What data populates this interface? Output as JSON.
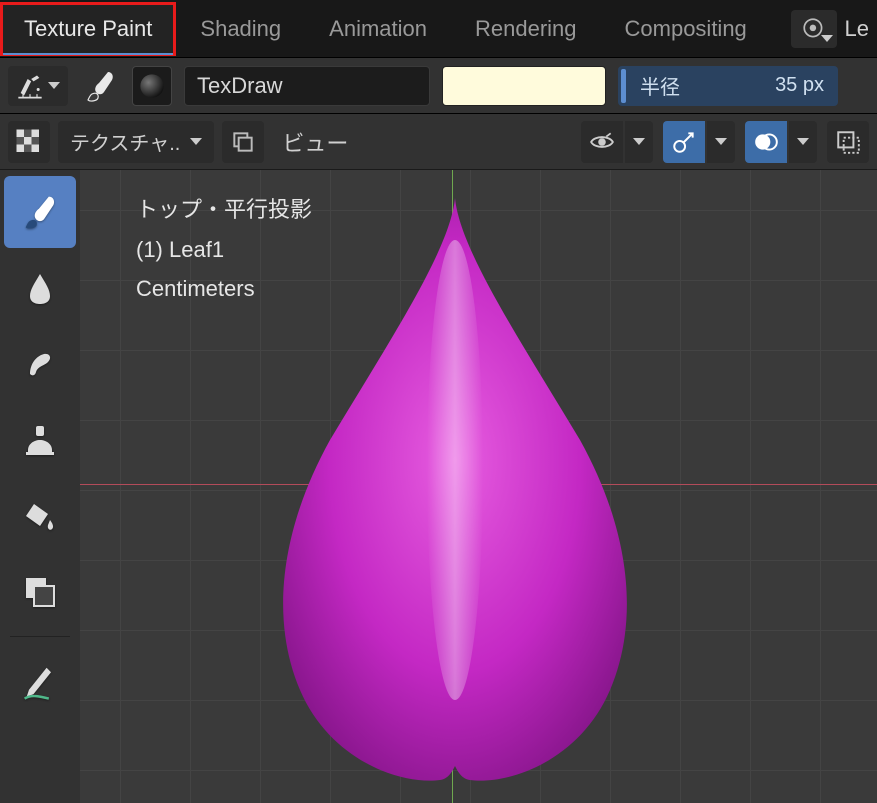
{
  "workspace": {
    "tabs": [
      "Texture Paint",
      "Shading",
      "Animation",
      "Rendering",
      "Compositing"
    ],
    "active_index": 0,
    "truncated_right": "Le"
  },
  "tool_header": {
    "brush_name": "TexDraw",
    "color": "#fffbdc",
    "radius_label": "半径",
    "radius_value": "35 px"
  },
  "sub_header": {
    "mode_label": "テクスチャ..",
    "view_menu": "ビュー"
  },
  "viewport": {
    "projection": "トップ・平行投影",
    "object": "(1) Leaf1",
    "units": "Centimeters",
    "object_color": "#c428c4"
  },
  "tools": {
    "items": [
      "draw",
      "smear",
      "smudge",
      "clone",
      "fill",
      "mask",
      "annotate"
    ],
    "active_index": 0
  }
}
